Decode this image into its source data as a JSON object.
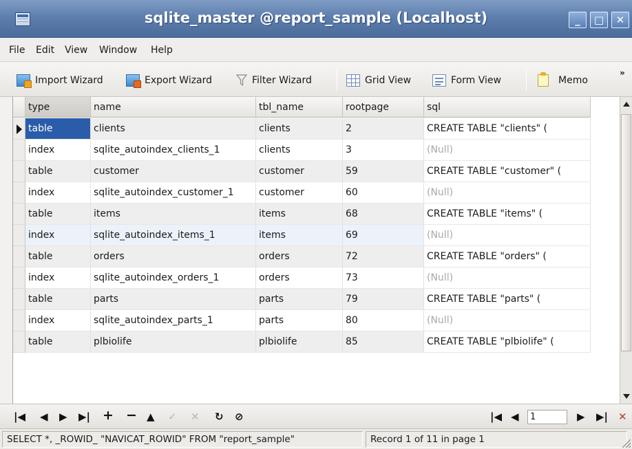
{
  "window": {
    "title": "sqlite_master @report_sample (Localhost)",
    "minimize_glyph": "_",
    "maximize_glyph": "□",
    "close_glyph": "✕"
  },
  "menu": [
    "File",
    "Edit",
    "View",
    "Window",
    "Help"
  ],
  "toolbar": {
    "import_wizard": "Import Wizard",
    "export_wizard": "Export Wizard",
    "filter_wizard": "Filter Wizard",
    "grid_view": "Grid View",
    "form_view": "Form View",
    "memo": "Memo",
    "overflow": "»"
  },
  "table": {
    "columns": [
      "type",
      "name",
      "tbl_name",
      "rootpage",
      "sql"
    ],
    "rows": [
      [
        "table",
        "clients",
        "clients",
        "2",
        "CREATE TABLE \"clients\" ("
      ],
      [
        "index",
        "sqlite_autoindex_clients_1",
        "clients",
        "3",
        "(Null)"
      ],
      [
        "table",
        "customer",
        "customer",
        "59",
        "CREATE TABLE \"customer\" ("
      ],
      [
        "index",
        "sqlite_autoindex_customer_1",
        "customer",
        "60",
        "(Null)"
      ],
      [
        "table",
        "items",
        "items",
        "68",
        "CREATE TABLE \"items\" ("
      ],
      [
        "index",
        "sqlite_autoindex_items_1",
        "items",
        "69",
        "(Null)"
      ],
      [
        "table",
        "orders",
        "orders",
        "72",
        "CREATE TABLE \"orders\" ("
      ],
      [
        "index",
        "sqlite_autoindex_orders_1",
        "orders",
        "73",
        "(Null)"
      ],
      [
        "table",
        "parts",
        "parts",
        "79",
        "CREATE TABLE \"parts\" ("
      ],
      [
        "index",
        "sqlite_autoindex_parts_1",
        "parts",
        "80",
        "(Null)"
      ],
      [
        "table",
        "plbiolife",
        "plbiolife",
        "85",
        "CREATE TABLE \"plbiolife\" ("
      ]
    ],
    "selected_row": 1
  },
  "navigator": {
    "first": "|◀",
    "prev": "◀",
    "next": "▶",
    "last": "▶|",
    "add": "+",
    "delete": "−",
    "edit": "▲",
    "post": "✓",
    "cancel": "✕",
    "refresh": "↻",
    "stop": "⊘",
    "page_first": "|◀",
    "page_prev": "◀",
    "page_number": "1",
    "page_next": "▶",
    "page_last": "▶|",
    "settings": "✕"
  },
  "status": {
    "query": "SELECT *, _ROWID_ \"NAVICAT_ROWID\" FROM \"report_sample\"",
    "record_info": "Record 1 of 11 in page 1"
  },
  "colors": {
    "titlebar": "#5e7fae",
    "selection": "#2a5caa",
    "null_text": "#a8a8a8"
  }
}
